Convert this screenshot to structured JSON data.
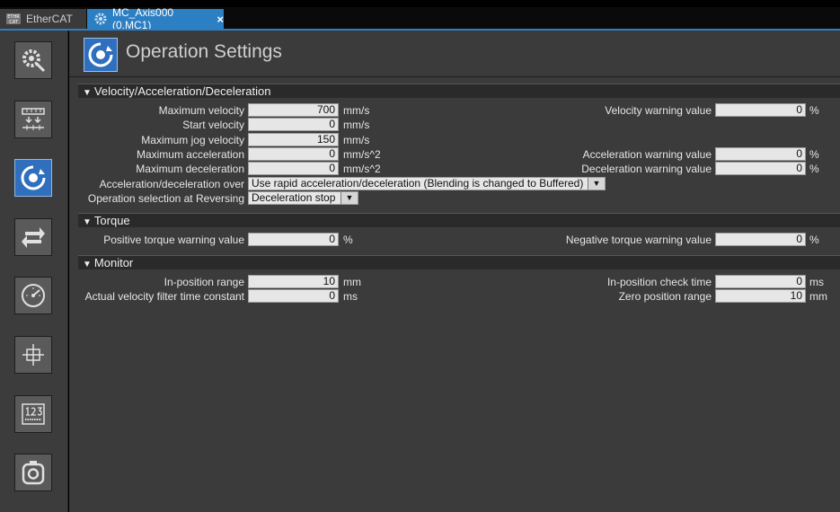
{
  "tabs": [
    {
      "label": "EtherCAT",
      "icon": "ethercat-icon",
      "active": false
    },
    {
      "label": "MC_Axis000 (0,MC1)",
      "icon": "gear-icon",
      "active": true,
      "close": "×"
    }
  ],
  "header": {
    "title": "Operation Settings",
    "icon": "operation-settings-icon"
  },
  "sidebar": [
    {
      "icon": "gear-settings-icon",
      "active": false
    },
    {
      "icon": "unit-conversion-icon",
      "active": false
    },
    {
      "icon": "operation-settings-icon",
      "active": true
    },
    {
      "icon": "other-operation-icon",
      "active": false
    },
    {
      "icon": "limit-gauge-icon",
      "active": false
    },
    {
      "icon": "position-count-icon",
      "active": false
    },
    {
      "icon": "servo-drive-icon",
      "active": false
    },
    {
      "icon": "homing-icon",
      "active": false
    }
  ],
  "sections": {
    "velocity": "Velocity/Acceleration/Deceleration",
    "torque": "Torque",
    "monitor": "Monitor"
  },
  "velocity": {
    "max_velocity": {
      "label": "Maximum velocity",
      "value": "700",
      "unit": "mm/s"
    },
    "start_velocity": {
      "label": "Start velocity",
      "value": "0",
      "unit": "mm/s"
    },
    "max_jog_velocity": {
      "label": "Maximum jog velocity",
      "value": "150",
      "unit": "mm/s"
    },
    "max_acceleration": {
      "label": "Maximum acceleration",
      "value": "0",
      "unit": "mm/s^2"
    },
    "max_deceleration": {
      "label": "Maximum deceleration",
      "value": "0",
      "unit": "mm/s^2"
    },
    "accel_decel_over": {
      "label": "Acceleration/deceleration over",
      "value": "Use rapid acceleration/deceleration (Blending is changed to Buffered)"
    },
    "reversing": {
      "label": "Operation selection at Reversing",
      "value": "Deceleration stop"
    },
    "velocity_warning": {
      "label": "Velocity warning value",
      "value": "0",
      "unit": "%"
    },
    "acceleration_warning": {
      "label": "Acceleration warning value",
      "value": "0",
      "unit": "%"
    },
    "deceleration_warning": {
      "label": "Deceleration warning value",
      "value": "0",
      "unit": "%"
    }
  },
  "torque": {
    "positive_warning": {
      "label": "Positive torque warning value",
      "value": "0",
      "unit": "%"
    },
    "negative_warning": {
      "label": "Negative torque warning value",
      "value": "0",
      "unit": "%"
    }
  },
  "monitor": {
    "in_position_range": {
      "label": "In-position range",
      "value": "10",
      "unit": "mm"
    },
    "velocity_filter": {
      "label": "Actual velocity filter time constant",
      "value": "0",
      "unit": "ms"
    },
    "in_position_check": {
      "label": "In-position check time",
      "value": "0",
      "unit": "ms"
    },
    "zero_position_range": {
      "label": "Zero position range",
      "value": "10",
      "unit": "mm"
    }
  },
  "dropdown_arrow": "▼",
  "section_arrow": "▼"
}
